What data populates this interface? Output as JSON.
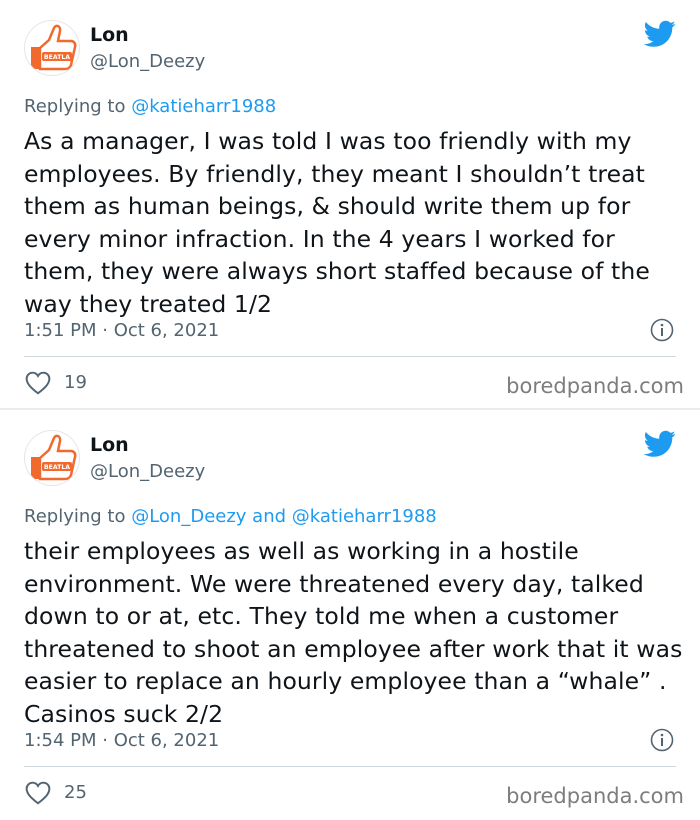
{
  "tweets": [
    {
      "author_name": "Lon",
      "author_handle": "@Lon_Deezy",
      "replying_prefix": "Replying to ",
      "replying_to": "@katieharr1988",
      "text": "As a manager, I was told I was too friendly with my employees. By friendly, they meant I shouldn’t treat them as human beings, & should write them up for every minor infraction. In the 4 years I worked for them, they were always short staffed because of the way they treated 1/2",
      "timestamp": "1:51 PM · Oct 6, 2021",
      "likes": "19",
      "watermark": "boredpanda.com"
    },
    {
      "author_name": "Lon",
      "author_handle": "@Lon_Deezy",
      "replying_prefix": "Replying to ",
      "replying_to": "@Lon_Deezy and @katieharr1988",
      "text": "their employees as well as working in a hostile environment. We were threatened every day, talked down to or at, etc. They told me when a customer threatened to shoot an employee after work that it was easier to replace an hourly employee than a “whale” . Casinos suck 2/2",
      "timestamp": "1:54 PM · Oct 6, 2021",
      "likes": "25",
      "watermark": "boredpanda.com"
    }
  ],
  "avatar": {
    "logo_text": "BEATLA",
    "icon": "thumbs-up-icon"
  },
  "colors": {
    "brand_blue": "#1d9bf0",
    "avatar_orange": "#f0692d",
    "text_secondary": "#536471"
  },
  "icons": {
    "brand": "twitter-bird-icon",
    "info": "info-icon",
    "like": "heart-icon"
  }
}
